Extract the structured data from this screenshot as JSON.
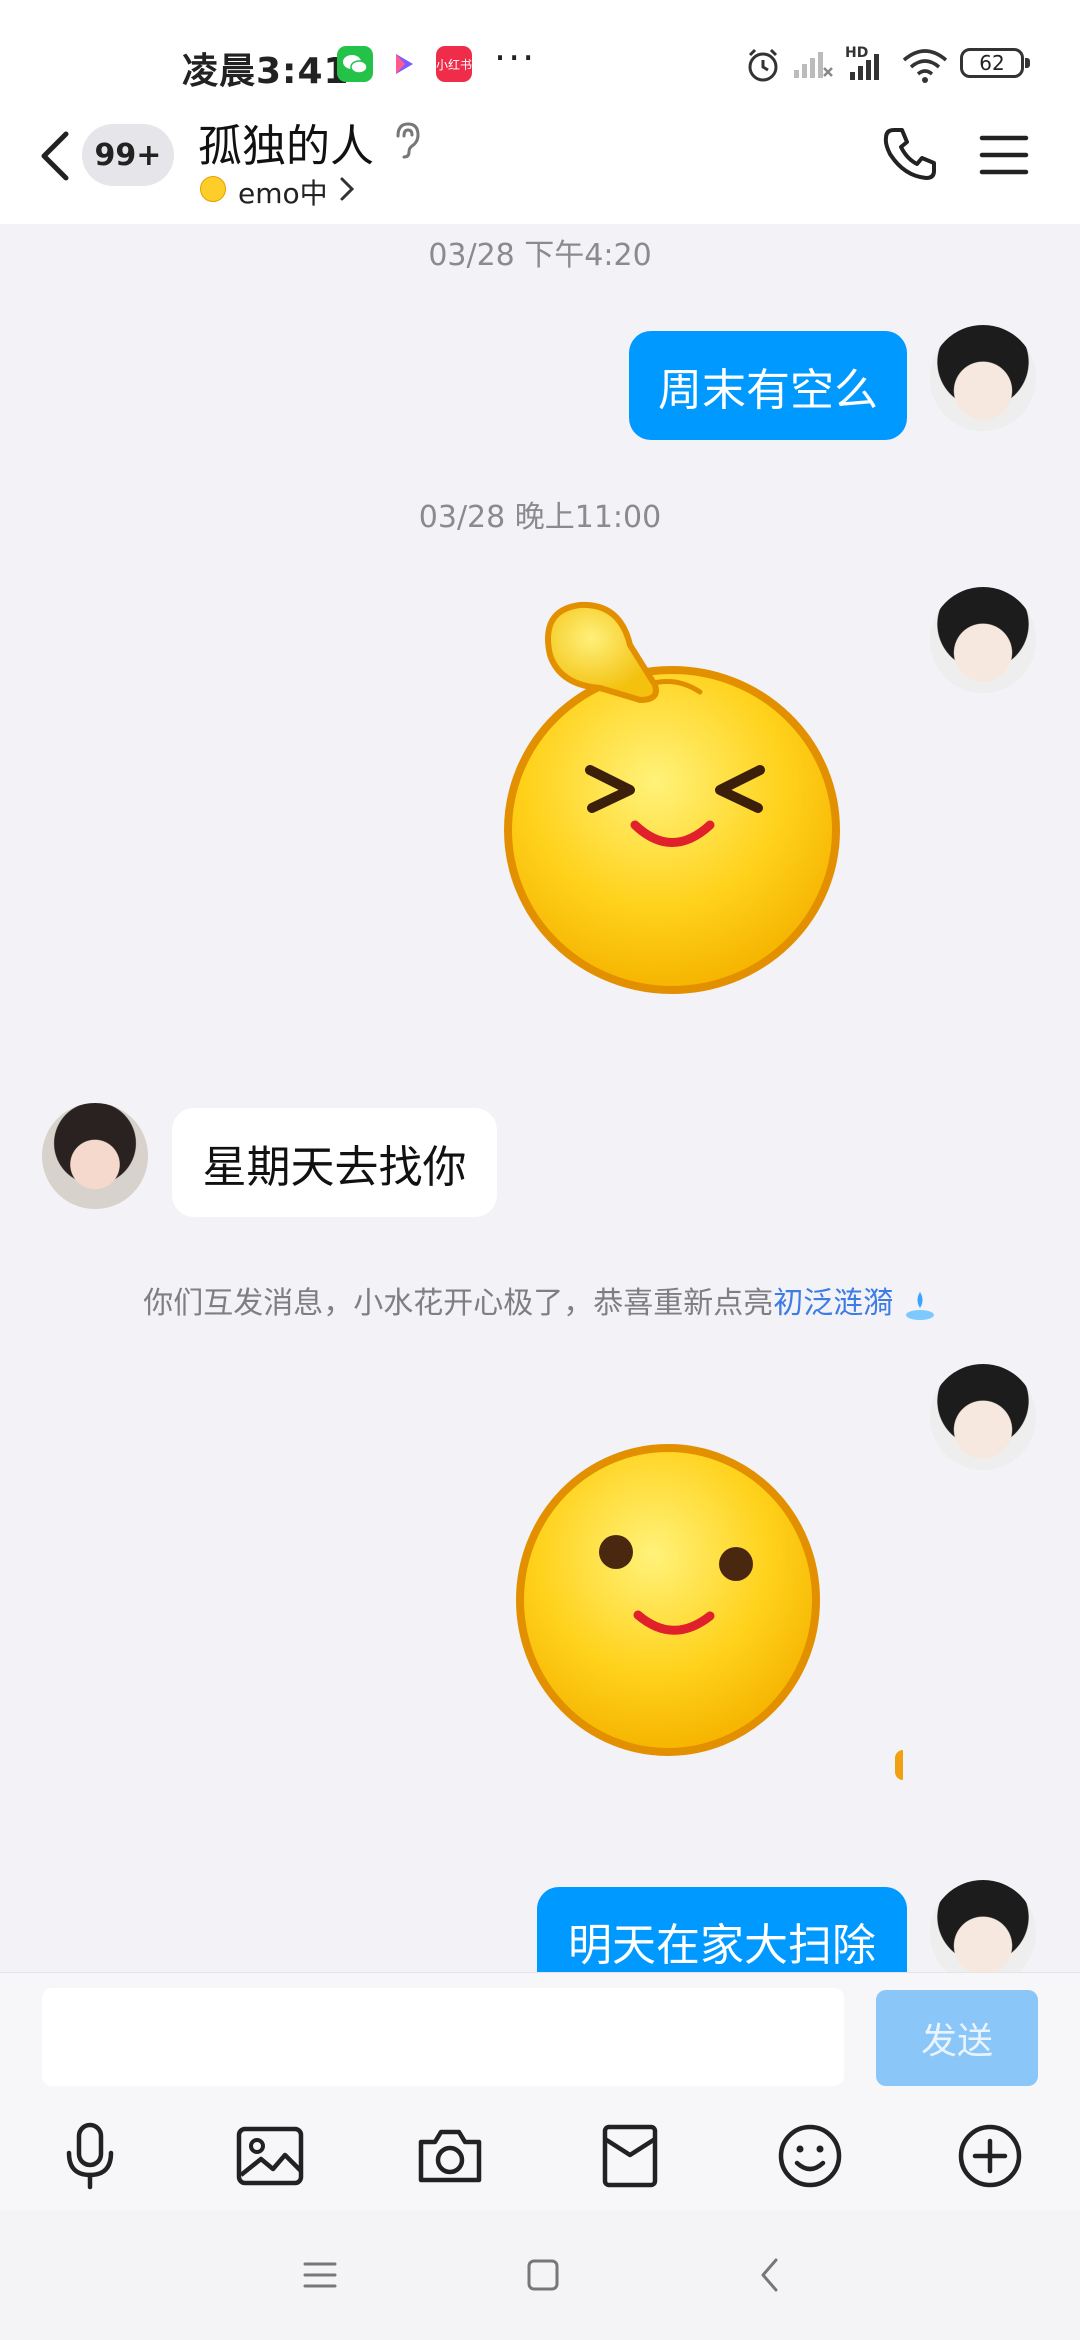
{
  "status_bar": {
    "time": "凌晨3:41",
    "app_red_label": "小红书",
    "more": "···",
    "network_tag": "HD",
    "battery": "62"
  },
  "header": {
    "unread_badge": "99+",
    "contact_name": "孤独的人",
    "status_text": "emo中"
  },
  "chat": {
    "timestamps": [
      "03/28 下午4:20",
      "03/28 晚上11:00"
    ],
    "messages": [
      {
        "from": "me",
        "text": "周末有空么"
      },
      {
        "from": "me",
        "type": "sticker",
        "sticker": "poke-head-emoji"
      },
      {
        "from": "contact",
        "text": "星期天去找你"
      },
      {
        "from": "me",
        "type": "sticker",
        "sticker": "smile-emoji"
      },
      {
        "from": "me",
        "text": "明天在家大扫除"
      }
    ],
    "system_notice": {
      "text": "你们互发消息，小水花开心极了，恭喜重新点亮",
      "link": "初泛涟漪"
    }
  },
  "input": {
    "placeholder": "",
    "send_label": "发送"
  },
  "toolbar": {
    "icons": [
      "microphone-icon",
      "image-icon",
      "camera-icon",
      "red-packet-icon",
      "emoji-icon",
      "plus-icon"
    ]
  },
  "colors": {
    "accent": "#0099ff",
    "send_disabled": "#8ac6f8",
    "background": "#f2f2f7",
    "link": "#3e7ce5"
  }
}
